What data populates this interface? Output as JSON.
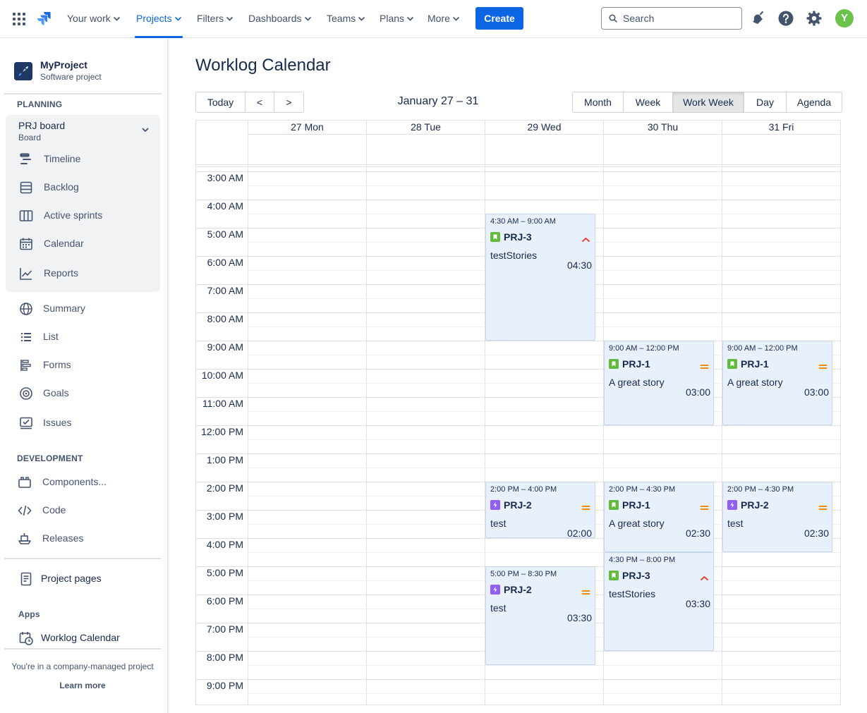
{
  "nav": {
    "items": [
      {
        "label": "Your work"
      },
      {
        "label": "Projects"
      },
      {
        "label": "Filters"
      },
      {
        "label": "Dashboards"
      },
      {
        "label": "Teams"
      },
      {
        "label": "Plans"
      },
      {
        "label": "More"
      }
    ],
    "active": "Projects",
    "create": "Create",
    "search_placeholder": "Search",
    "avatar_letter": "Y",
    "accent": "#0c66e4"
  },
  "sidebar": {
    "project_name": "MyProject",
    "project_type": "Software project",
    "planning_heading": "PLANNING",
    "board_title": "PRJ board",
    "board_sub": "Board",
    "planning_items": [
      {
        "label": "Timeline",
        "icon": "timeline-icon"
      },
      {
        "label": "Backlog",
        "icon": "backlog-icon"
      },
      {
        "label": "Active sprints",
        "icon": "active-sprints-icon"
      },
      {
        "label": "Calendar",
        "icon": "calendar-icon"
      },
      {
        "label": "Reports",
        "icon": "reports-icon"
      }
    ],
    "other_items": [
      {
        "label": "Summary",
        "icon": "globe-icon"
      },
      {
        "label": "List",
        "icon": "list-icon"
      },
      {
        "label": "Forms",
        "icon": "forms-icon"
      },
      {
        "label": "Goals",
        "icon": "goals-icon"
      },
      {
        "label": "Issues",
        "icon": "issues-icon"
      }
    ],
    "development_heading": "DEVELOPMENT",
    "development_items": [
      {
        "label": "Components...",
        "icon": "components-icon"
      },
      {
        "label": "Code",
        "icon": "code-icon"
      },
      {
        "label": "Releases",
        "icon": "releases-icon"
      }
    ],
    "project_pages": "Project pages",
    "apps_heading": "Apps",
    "worklog_calendar": "Worklog Calendar",
    "footer_note": "You're in a company-managed project",
    "learn_more": "Learn more"
  },
  "main": {
    "title": "Worklog Calendar",
    "nav_buttons": [
      "Today",
      "<",
      ">"
    ],
    "date_range": "January 27 – 31",
    "views": [
      "Month",
      "Week",
      "Work Week",
      "Day",
      "Agenda"
    ],
    "active_view": "Work Week",
    "days": [
      "27 Mon",
      "28 Tue",
      "29 Wed",
      "30 Thu",
      "31 Fri"
    ],
    "time_labels": [
      "3:00 AM",
      "4:00 AM",
      "5:00 AM",
      "6:00 AM",
      "7:00 AM",
      "8:00 AM",
      "9:00 AM",
      "10:00 AM",
      "11:00 AM",
      "12:00 PM",
      "1:00 PM",
      "2:00 PM",
      "3:00 PM",
      "4:00 PM",
      "5:00 PM",
      "6:00 PM",
      "7:00 PM",
      "8:00 PM",
      "9:00 PM"
    ],
    "events": [
      {
        "day": 2,
        "start": 4.5,
        "end": 9.0,
        "time": "4:30 AM – 9:00 AM",
        "key": "PRJ-3",
        "type": "story",
        "priority": "high",
        "title": "testStories",
        "duration": "04:30"
      },
      {
        "day": 3,
        "start": 9.0,
        "end": 12.0,
        "time": "9:00 AM – 12:00 PM",
        "key": "PRJ-1",
        "type": "story",
        "priority": "medium",
        "title": "A great story",
        "duration": "03:00"
      },
      {
        "day": 4,
        "start": 9.0,
        "end": 12.0,
        "time": "9:00 AM – 12:00 PM",
        "key": "PRJ-1",
        "type": "story",
        "priority": "medium",
        "title": "A great story",
        "duration": "03:00"
      },
      {
        "day": 2,
        "start": 14.0,
        "end": 16.0,
        "time": "2:00 PM – 4:00 PM",
        "key": "PRJ-2",
        "type": "subtask",
        "priority": "medium",
        "title": "test",
        "duration": "02:00"
      },
      {
        "day": 3,
        "start": 14.0,
        "end": 16.5,
        "time": "2:00 PM – 4:30 PM",
        "key": "PRJ-1",
        "type": "story",
        "priority": "medium",
        "title": "A great story",
        "duration": "02:30"
      },
      {
        "day": 4,
        "start": 14.0,
        "end": 16.5,
        "time": "2:00 PM – 4:30 PM",
        "key": "PRJ-2",
        "type": "subtask",
        "priority": "medium",
        "title": "test",
        "duration": "02:30"
      },
      {
        "day": 2,
        "start": 17.0,
        "end": 20.5,
        "time": "5:00 PM – 8:30 PM",
        "key": "PRJ-2",
        "type": "subtask",
        "priority": "medium",
        "title": "test",
        "duration": "03:30"
      },
      {
        "day": 3,
        "start": 16.5,
        "end": 20.0,
        "time": "4:30 PM – 8:00 PM",
        "key": "PRJ-3",
        "type": "story",
        "priority": "high",
        "title": "testStories",
        "duration": "03:30"
      }
    ],
    "colors": {
      "event_bg": "#e8f0fb",
      "story": "#63ba3c",
      "subtask": "#8f5ff5",
      "priority_high": "#e2483d",
      "priority_medium": "#f18d13"
    }
  }
}
